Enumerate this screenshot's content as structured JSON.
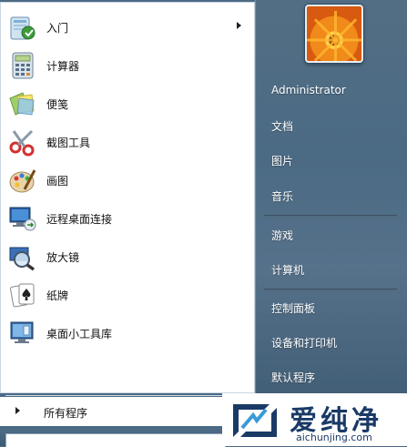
{
  "programs": [
    {
      "label": "入门",
      "icon": "getting-started-icon",
      "has_submenu": true
    },
    {
      "label": "计算器",
      "icon": "calculator-icon",
      "has_submenu": false
    },
    {
      "label": "便笺",
      "icon": "sticky-notes-icon",
      "has_submenu": false
    },
    {
      "label": "截图工具",
      "icon": "snipping-tool-icon",
      "has_submenu": false
    },
    {
      "label": "画图",
      "icon": "paint-icon",
      "has_submenu": false
    },
    {
      "label": "远程桌面连接",
      "icon": "remote-desktop-icon",
      "has_submenu": false
    },
    {
      "label": "放大镜",
      "icon": "magnifier-icon",
      "has_submenu": false
    },
    {
      "label": "纸牌",
      "icon": "solitaire-icon",
      "has_submenu": false
    },
    {
      "label": "桌面小工具库",
      "icon": "desktop-gadgets-icon",
      "has_submenu": false
    }
  ],
  "all_programs": {
    "label": "所有程序"
  },
  "right": {
    "user": "Administrator",
    "documents": "文档",
    "pictures": "图片",
    "music": "音乐",
    "games": "游戏",
    "computer": "计算机",
    "control_panel": "控制面板",
    "devices_printers": "设备和打印机",
    "default_programs": "默认程序"
  },
  "watermark": {
    "brand": "爱纯净",
    "url": "aichunjing.com"
  },
  "colors": {
    "right_panel": "#4b6a84",
    "left_panel": "#ffffff",
    "watermark_text": "#1a3a66"
  }
}
